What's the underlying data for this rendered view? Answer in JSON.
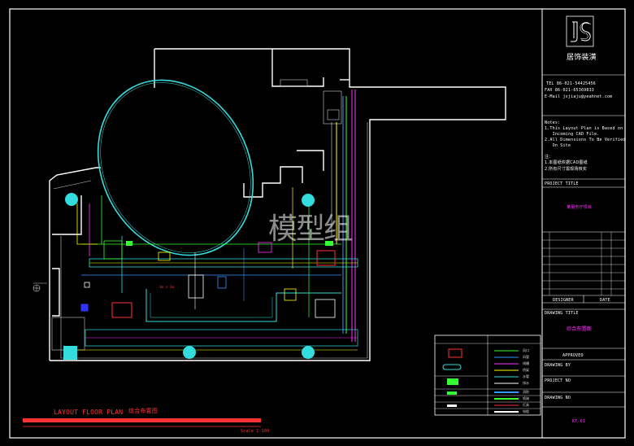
{
  "title_block": {
    "logo_letters": "JS",
    "company_name": "居饰装潢",
    "tel": "TEL 86-021-54425456",
    "fax": "FAX 86-021-65369833",
    "email": "E-Mail jsjiaju@yeahnet.com",
    "notes_heading": "Notes:",
    "notes": [
      "1.This Layout Plan is Based on",
      "   Incoming CAD File.",
      "2.All Dimensions To Be Verified",
      "   On Site"
    ],
    "notes_cn_heading": "注:",
    "notes_cn": [
      "1.本图纸依据CAD图纸",
      "2.所有尺寸需现场核实"
    ],
    "project_title_label": "PROJECT TITLE",
    "project_title_value": "某服务厅项目",
    "designer_label": "DESIGNER",
    "date_label": "DATE",
    "drawing_title_label": "DRAWING TITLE",
    "drawing_title_value": "综合布置图",
    "approved_label": "APPROVED",
    "drawn_by_label": "DRAWING BY",
    "project_no_label": "PROJECT NO",
    "drawing_no_label": "DRAWING NO",
    "drawing_no_value": "KT-01"
  },
  "plan": {
    "caption": "LAYOUT FLOOR PLAN",
    "caption_cn": "综合布置图",
    "scale": "Scale 1:100",
    "room_label": "3m x 3m"
  },
  "legend": {
    "items": [
      "风口",
      "风管",
      "线槽",
      "桥架",
      "水管",
      "排水",
      "消防",
      "喷淋",
      "灯具",
      "电缆"
    ]
  },
  "watermark": "模型组",
  "colors": {
    "background": "#000000",
    "sheet_border": "#ffffff",
    "wall": "#ffffff",
    "ellipse": "#33dddd",
    "caption": "#ff3333",
    "accent_magenta": "#ff33ff",
    "accent_yellow": "#ffff00",
    "accent_green": "#33ff33"
  }
}
